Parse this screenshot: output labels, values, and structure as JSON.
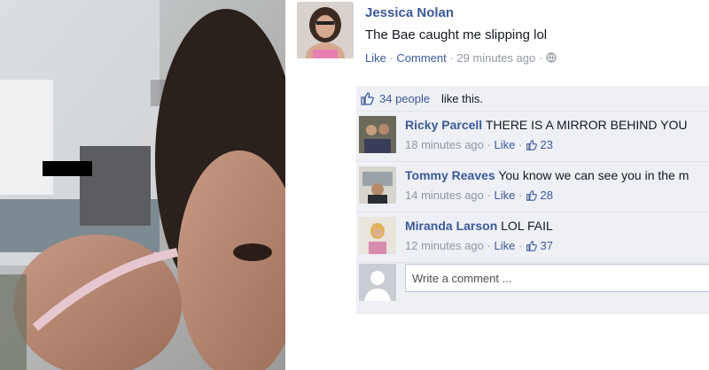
{
  "post": {
    "author": "Jessica Nolan",
    "status_text": "The Bae caught me slipping lol",
    "like_label": "Like",
    "comment_label": "Comment",
    "timestamp": "29 minutes ago",
    "sep": " · ",
    "audience_icon": "globe-icon"
  },
  "likes": {
    "count_text": "34 people",
    "suffix": "like this."
  },
  "comments": [
    {
      "name": "Ricky Parcell",
      "text": "THERE IS A MIRROR BEHIND YOU",
      "time": "18 minutes ago",
      "like_label": "Like",
      "likes": "23"
    },
    {
      "name": "Tommy Reaves",
      "text": "You know we can see you in the m",
      "time": "14 minutes ago",
      "like_label": "Like",
      "likes": "28"
    },
    {
      "name": "Miranda Larson",
      "text": "LOL FAIL",
      "time": "12 minutes ago",
      "like_label": "Like",
      "likes": "37"
    }
  ],
  "composer": {
    "placeholder": "Write a comment ..."
  },
  "colors": {
    "link": "#3b5998",
    "meta": "#9197a3",
    "ufi_bg": "#eef0f5"
  }
}
